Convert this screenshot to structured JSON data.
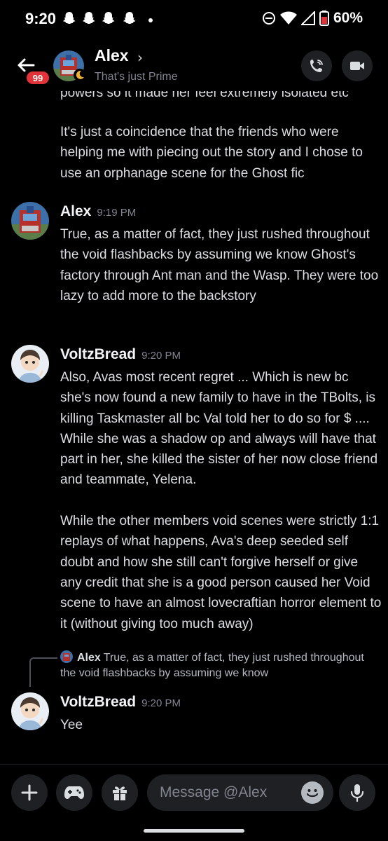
{
  "status_bar": {
    "time": "9:20",
    "battery": "60%",
    "icons": [
      "snapchat-icon",
      "snapchat-icon",
      "snapchat-icon",
      "snapchat-icon",
      "dnd-icon",
      "wifi-icon",
      "signal-icon",
      "battery-icon"
    ]
  },
  "header": {
    "name": "Alex",
    "chevron": "›",
    "custom_status": "That's just Prime",
    "unread_badge": "99",
    "accent": "#e0343a"
  },
  "messages": {
    "continuation": {
      "partial_line": "powers so it made her feel extremely isolated etc",
      "text": "It's just a coincidence that the friends who were helping me with piecing out the story and I chose to use an orphanage scene for the Ghost fic"
    },
    "group1": {
      "author": "Alex",
      "time": "9:19 PM",
      "text": "True, as a matter of fact, they just rushed throughout the void flashbacks by assuming we know Ghost's factory through Ant man and the Wasp. They were too lazy to add more to the backstory"
    },
    "group2": {
      "author": "VoltzBread",
      "time": "9:20 PM",
      "text": "Also, Avas most recent regret ... Which is new bc she's now found a new family to have in the TBolts, is killing Taskmaster all bc Val told her to do so for $ .... While she was a shadow op and always will have that part in her, she killed the sister of her now close friend and teammate, Yelena.\n\nWhile the other members void scenes were strictly 1:1 replays of what happens, Ava's deep seeded self doubt and how she still can't forgive herself or give any credit that she is a good person caused her Void scene to have an almost lovecraftian horror element to it (without giving too much away)"
    },
    "reply": {
      "author": "Alex",
      "preview": "True, as a matter of fact, they just rushed throughout the void flashbacks by assuming we know"
    },
    "group3": {
      "author": "VoltzBread",
      "time": "9:20 PM",
      "text": "Yee"
    }
  },
  "composer": {
    "placeholder": "Message @Alex"
  }
}
